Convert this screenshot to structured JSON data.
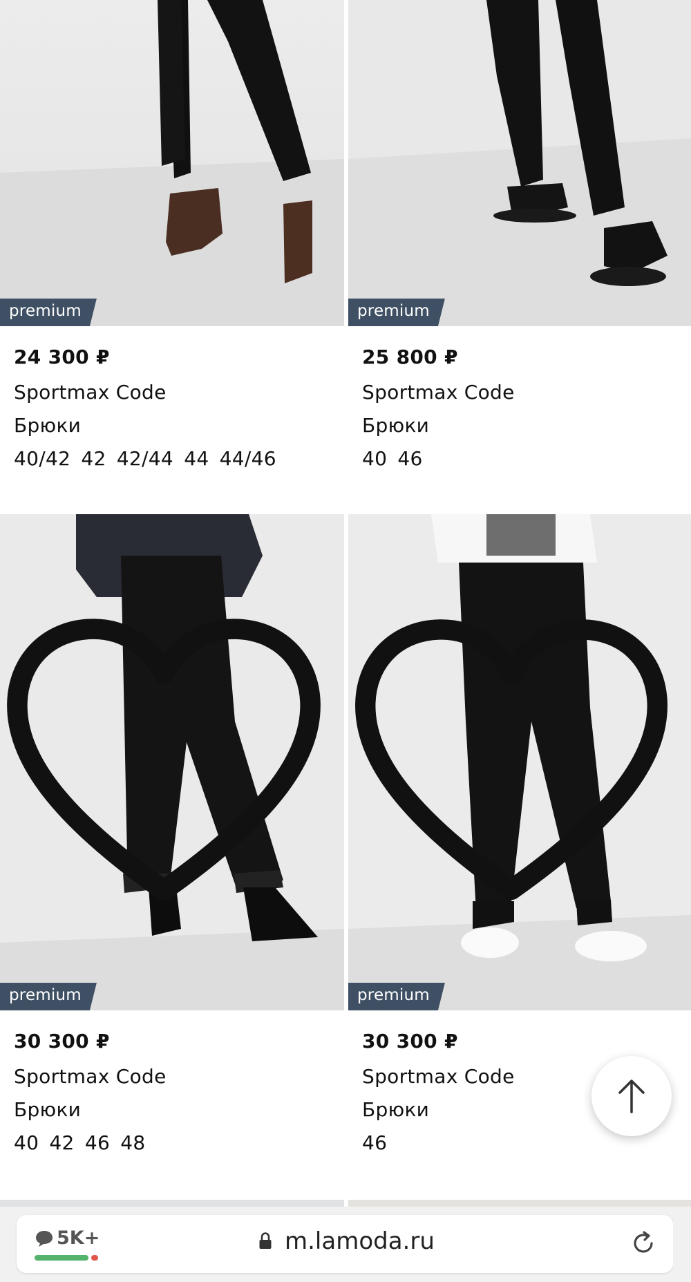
{
  "badge_label": "premium",
  "products": [
    {
      "price": "24 300 ₽",
      "brand": "Sportmax Code",
      "type": "Брюки",
      "sizes": "40/42  42  42/44  44  44/46"
    },
    {
      "price": "25 800 ₽",
      "brand": "Sportmax Code",
      "type": "Брюки",
      "sizes": "40  46"
    },
    {
      "price": "30 300 ₽",
      "brand": "Sportmax Code",
      "type": "Брюки",
      "sizes": "40  42  46  48"
    },
    {
      "price": "30 300 ₽",
      "brand": "Sportmax Code",
      "type": "Брюки",
      "sizes": "46"
    }
  ],
  "browser": {
    "chat_count": "5K+",
    "url": "m.lamoda.ru"
  },
  "colors": {
    "badge_bg": "#3f5064",
    "progress_green": "#54b36b",
    "progress_red": "#e2574c"
  },
  "icons": [
    "heart-outline-icon",
    "arrow-up-icon",
    "chat-bubble-icon",
    "lock-icon",
    "reload-icon"
  ]
}
